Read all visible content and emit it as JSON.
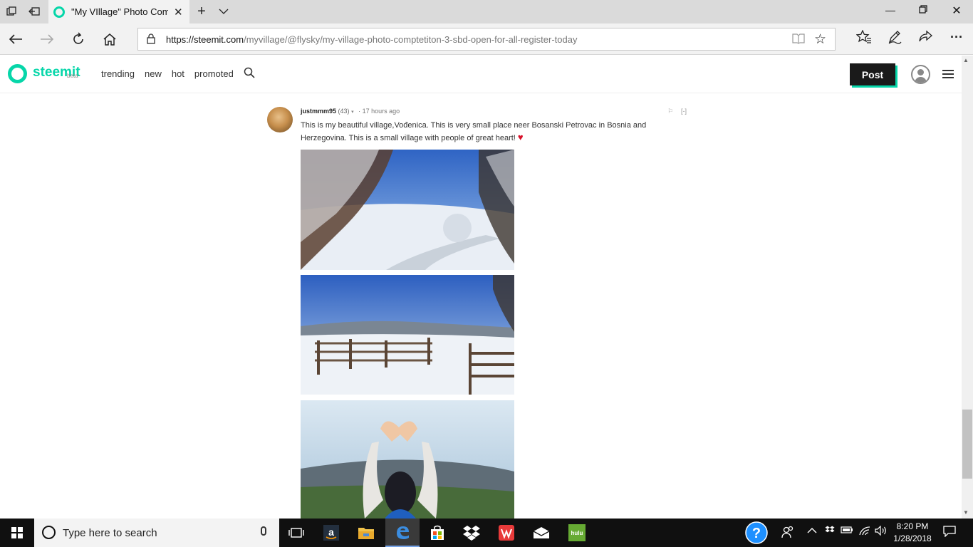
{
  "browser": {
    "tab_title": "\"My VIllage\" Photo Com",
    "url_host": "https://steemit.com",
    "url_path": "/myvillage/@flysky/my-village-photo-comptetiton-3-sbd-open-for-all-register-today"
  },
  "site": {
    "logo_text": "steemit",
    "logo_badge": "beta",
    "nav": [
      "trending",
      "new",
      "hot",
      "promoted"
    ],
    "post_label": "Post"
  },
  "comment": {
    "author": "justmmm95",
    "reputation": "(43)",
    "time": "17 hours ago",
    "collapse_label": "[-]",
    "text_line1": "This is my beautiful village,Vođenica. This is very small place neer Bosanski Petrovac in Bosnia and",
    "text_line2": "Herzegovina. This is a small village with people of great heart!"
  },
  "taskbar": {
    "search_placeholder": "Type here to search",
    "time": "8:20 PM",
    "date": "1/28/2018",
    "hulu_label": "hulu"
  },
  "colors": {
    "brand": "#06d6a9",
    "post_button": "#1a1a1a",
    "heart": "#d8112a"
  },
  "icons": [
    "tab-actions-icon",
    "back-tabs-icon",
    "steemit-favicon",
    "tab-close-icon",
    "new-tab-icon",
    "tab-list-icon",
    "minimize-icon",
    "restore-icon",
    "window-close-icon",
    "back-icon",
    "forward-icon",
    "refresh-icon",
    "home-icon",
    "lock-icon",
    "reading-view-icon",
    "favorite-star-icon",
    "favorites-hub-icon",
    "pen-icon",
    "share-icon",
    "more-icon",
    "steemit-logo-icon",
    "search-icon",
    "user-icon",
    "hamburger-menu-icon",
    "flag-icon",
    "heart-icon",
    "windows-start-icon",
    "cortana-icon",
    "microphone-icon",
    "task-view-icon",
    "amazon-icon",
    "file-explorer-icon",
    "edge-icon",
    "store-icon",
    "dropbox-icon",
    "wps-office-icon",
    "mail-icon",
    "hulu-icon",
    "help-icon",
    "people-icon",
    "tray-chevron-icon",
    "dropbox-tray-icon",
    "battery-icon",
    "wifi-icon",
    "volume-icon",
    "notification-icon"
  ]
}
